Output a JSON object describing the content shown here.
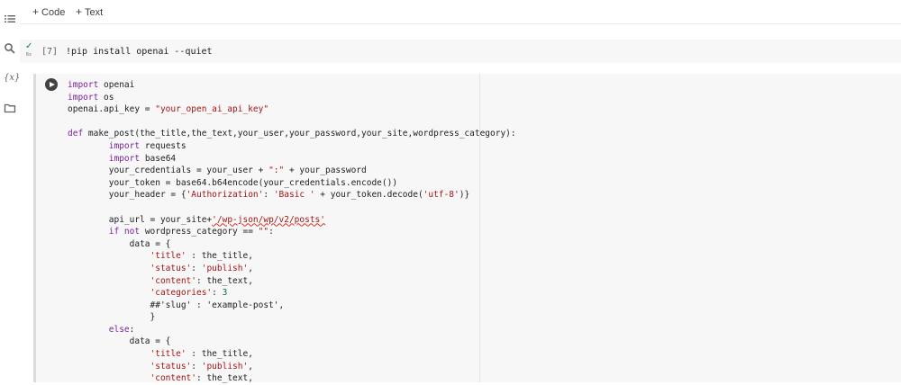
{
  "toolbar": {
    "add_code_label": "Code",
    "add_text_label": "Text"
  },
  "sidebar": {
    "variables_label": "{x}"
  },
  "cell1": {
    "status_time": "6s",
    "exec_count": "[7]",
    "code": "!pip install openai --quiet"
  },
  "cell2": {
    "lines": [
      [
        {
          "t": "import",
          "c": "kw"
        },
        {
          "t": " openai"
        }
      ],
      [
        {
          "t": "import",
          "c": "kw"
        },
        {
          "t": " os"
        }
      ],
      [
        {
          "t": "openai.api_key = "
        },
        {
          "t": "\"your_open_ai_api_key\"",
          "c": "str"
        }
      ],
      [],
      [
        {
          "t": "def ",
          "c": "kw"
        },
        {
          "t": "make_post(the_title,the_text,your_user,your_password,your_site,wordpress_category):"
        }
      ],
      [
        {
          "t": "        "
        },
        {
          "t": "import",
          "c": "kw"
        },
        {
          "t": " requests"
        }
      ],
      [
        {
          "t": "        "
        },
        {
          "t": "import",
          "c": "kw"
        },
        {
          "t": " base64"
        }
      ],
      [
        {
          "t": "        your_credentials = your_user + "
        },
        {
          "t": "\":\"",
          "c": "str"
        },
        {
          "t": " + your_password"
        }
      ],
      [
        {
          "t": "        your_token = base64.b64encode(your_credentials.encode())"
        }
      ],
      [
        {
          "t": "        your_header = {"
        },
        {
          "t": "'Authorization'",
          "c": "str"
        },
        {
          "t": ": "
        },
        {
          "t": "'Basic '",
          "c": "str"
        },
        {
          "t": " + your_token.decode("
        },
        {
          "t": "'utf-8'",
          "c": "str"
        },
        {
          "t": ")}"
        }
      ],
      [],
      [
        {
          "t": "        api_url = your_site+"
        },
        {
          "t": "'/wp-json/wp/v2/posts'",
          "c": "str squig"
        }
      ],
      [
        {
          "t": "        "
        },
        {
          "t": "if not",
          "c": "kw"
        },
        {
          "t": " wordpress_category == "
        },
        {
          "t": "\"\"",
          "c": "str"
        },
        {
          "t": ":"
        }
      ],
      [
        {
          "t": "            data = {"
        }
      ],
      [
        {
          "t": "                "
        },
        {
          "t": "'title'",
          "c": "str"
        },
        {
          "t": " : the_title,"
        }
      ],
      [
        {
          "t": "                "
        },
        {
          "t": "'status'",
          "c": "str"
        },
        {
          "t": ": "
        },
        {
          "t": "'publish'",
          "c": "str"
        },
        {
          "t": ","
        }
      ],
      [
        {
          "t": "                "
        },
        {
          "t": "'content'",
          "c": "str"
        },
        {
          "t": ": the_text,"
        }
      ],
      [
        {
          "t": "                "
        },
        {
          "t": "'categories'",
          "c": "str"
        },
        {
          "t": ": "
        },
        {
          "t": "3",
          "c": "num"
        }
      ],
      [
        {
          "t": "                ##'slug' : 'example-post',"
        }
      ],
      [
        {
          "t": "                }"
        }
      ],
      [
        {
          "t": "        "
        },
        {
          "t": "else",
          "c": "kw"
        },
        {
          "t": ":"
        }
      ],
      [
        {
          "t": "            data = {"
        }
      ],
      [
        {
          "t": "                "
        },
        {
          "t": "'title'",
          "c": "str"
        },
        {
          "t": " : the_title,"
        }
      ],
      [
        {
          "t": "                "
        },
        {
          "t": "'status'",
          "c": "str"
        },
        {
          "t": ": "
        },
        {
          "t": "'publish'",
          "c": "str"
        },
        {
          "t": ","
        }
      ],
      [
        {
          "t": "                "
        },
        {
          "t": "'content'",
          "c": "str"
        },
        {
          "t": ": the_text,"
        }
      ]
    ]
  }
}
